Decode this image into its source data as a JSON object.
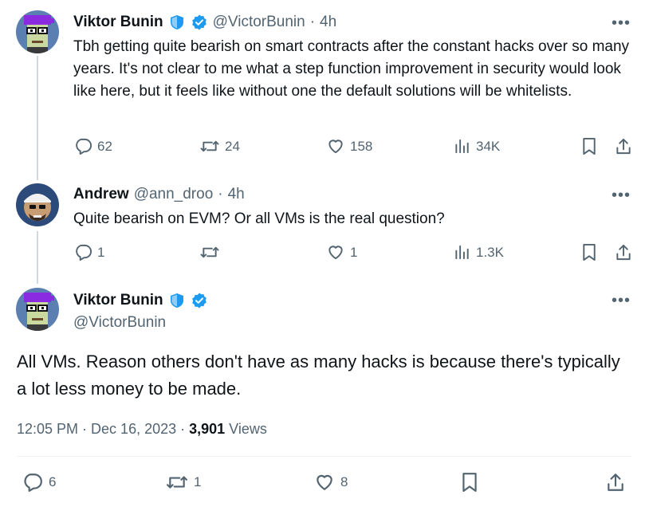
{
  "tweets": [
    {
      "name": "Viktor Bunin",
      "handle": "@VictorBunin",
      "separator": "·",
      "time": "4h",
      "text": "Tbh getting quite bearish on smart contracts after the constant hacks over so many years. It's not clear to me what a step function improvement in security would look like here, but it feels like without one the default solutions will be whitelists.",
      "replies": "62",
      "retweets": "24",
      "likes": "158",
      "views": "34K"
    },
    {
      "name": "Andrew",
      "handle": "@ann_droo",
      "separator": "·",
      "time": "4h",
      "text": "Quite bearish on EVM? Or all VMs is the real question?",
      "replies": "1",
      "retweets": "",
      "likes": "1",
      "views": "1.3K"
    }
  ],
  "main": {
    "name": "Viktor Bunin",
    "handle": "@VictorBunin",
    "text": "All VMs. Reason others don't have as many hacks is because there's typically a lot less money to be made.",
    "timestamp": "12:05 PM · Dec 16, 2023 · ",
    "view_count": "3,901",
    "views_label": " Views",
    "replies": "6",
    "retweets": "1",
    "likes": "8"
  },
  "colors": {
    "verified": "#1d9bf0",
    "shield": "#1d9bf0",
    "muted": "#536471",
    "avatar_purple": "#8a2be2",
    "avatar_bg": "#4a6fa5"
  },
  "icons": [
    "more-icon",
    "reply-icon",
    "retweet-icon",
    "like-icon",
    "views-icon",
    "bookmark-icon",
    "share-icon",
    "verified-icon",
    "shield-icon"
  ]
}
